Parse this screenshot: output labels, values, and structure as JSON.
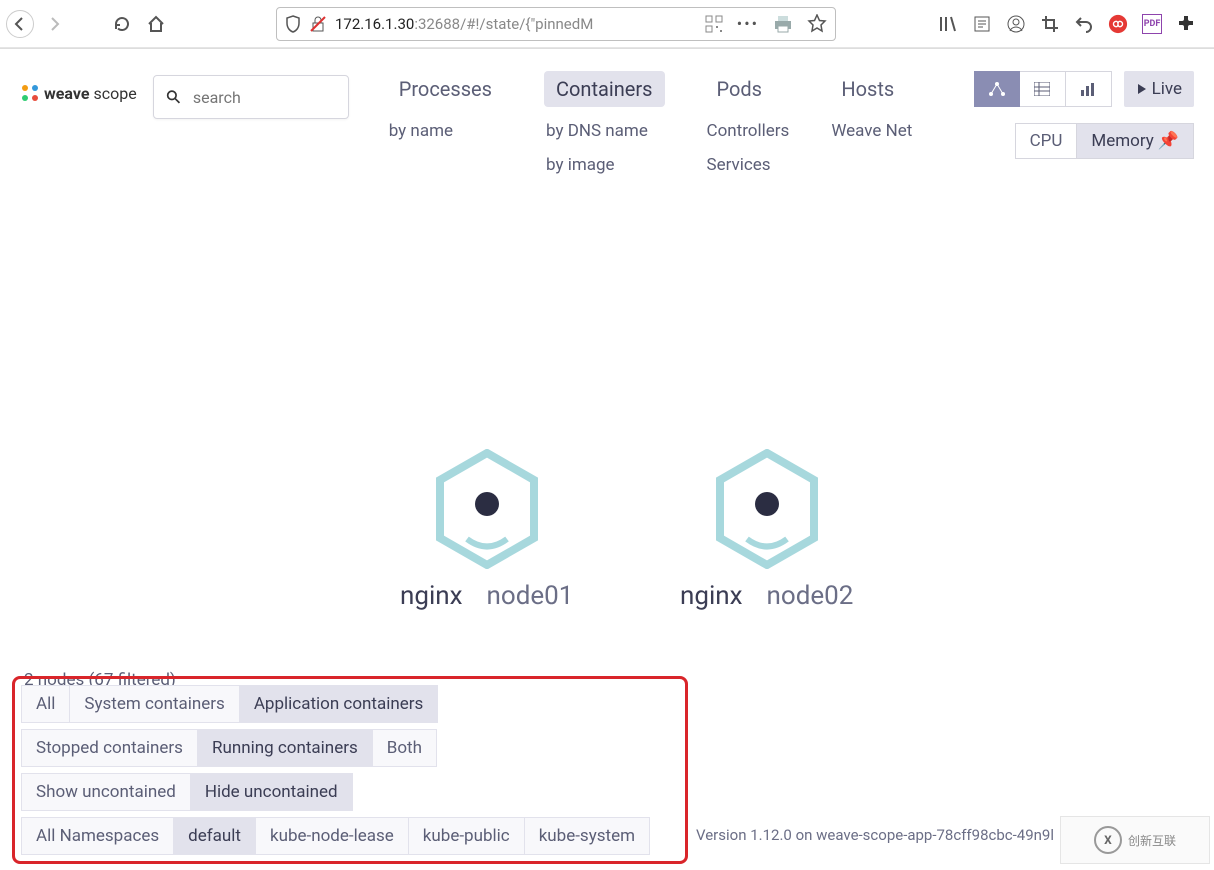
{
  "browser": {
    "url_ip": "172.16.1.30",
    "url_rest": ":32688/#!/state/{\"pinnedM"
  },
  "app": {
    "logo_bold": "weave",
    "logo_light": "scope",
    "search_placeholder": "search",
    "topology": {
      "processes": {
        "head": "Processes",
        "subs": [
          "by name"
        ]
      },
      "containers": {
        "head": "Containers",
        "subs": [
          "by DNS name",
          "by image"
        ]
      },
      "pods": {
        "head": "Pods",
        "subs": [
          "Controllers",
          "Services"
        ]
      },
      "hosts": {
        "head": "Hosts",
        "subs": [
          "Weave Net"
        ]
      }
    },
    "live_label": "Live",
    "metrics": {
      "cpu": "CPU",
      "memory": "Memory"
    },
    "nodes": [
      {
        "major": "nginx",
        "minor": "node01"
      },
      {
        "major": "nginx",
        "minor": "node02"
      }
    ],
    "status": "2 nodes (67 filtered)",
    "filters": {
      "row1": [
        {
          "label": "All",
          "active": false
        },
        {
          "label": "System containers",
          "active": false
        },
        {
          "label": "Application containers",
          "active": true
        }
      ],
      "row2": [
        {
          "label": "Stopped containers",
          "active": false
        },
        {
          "label": "Running containers",
          "active": true
        },
        {
          "label": "Both",
          "active": false
        }
      ],
      "row3": [
        {
          "label": "Show uncontained",
          "active": false
        },
        {
          "label": "Hide uncontained",
          "active": true
        }
      ],
      "row4": [
        {
          "label": "All Namespaces",
          "active": false
        },
        {
          "label": "default",
          "active": true
        },
        {
          "label": "kube-node-lease",
          "active": false
        },
        {
          "label": "kube-public",
          "active": false
        },
        {
          "label": "kube-system",
          "active": false
        }
      ]
    },
    "version": "Version 1.12.0 on weave-scope-app-78cff98cbc-49n9l",
    "watermark": "创新互联"
  }
}
